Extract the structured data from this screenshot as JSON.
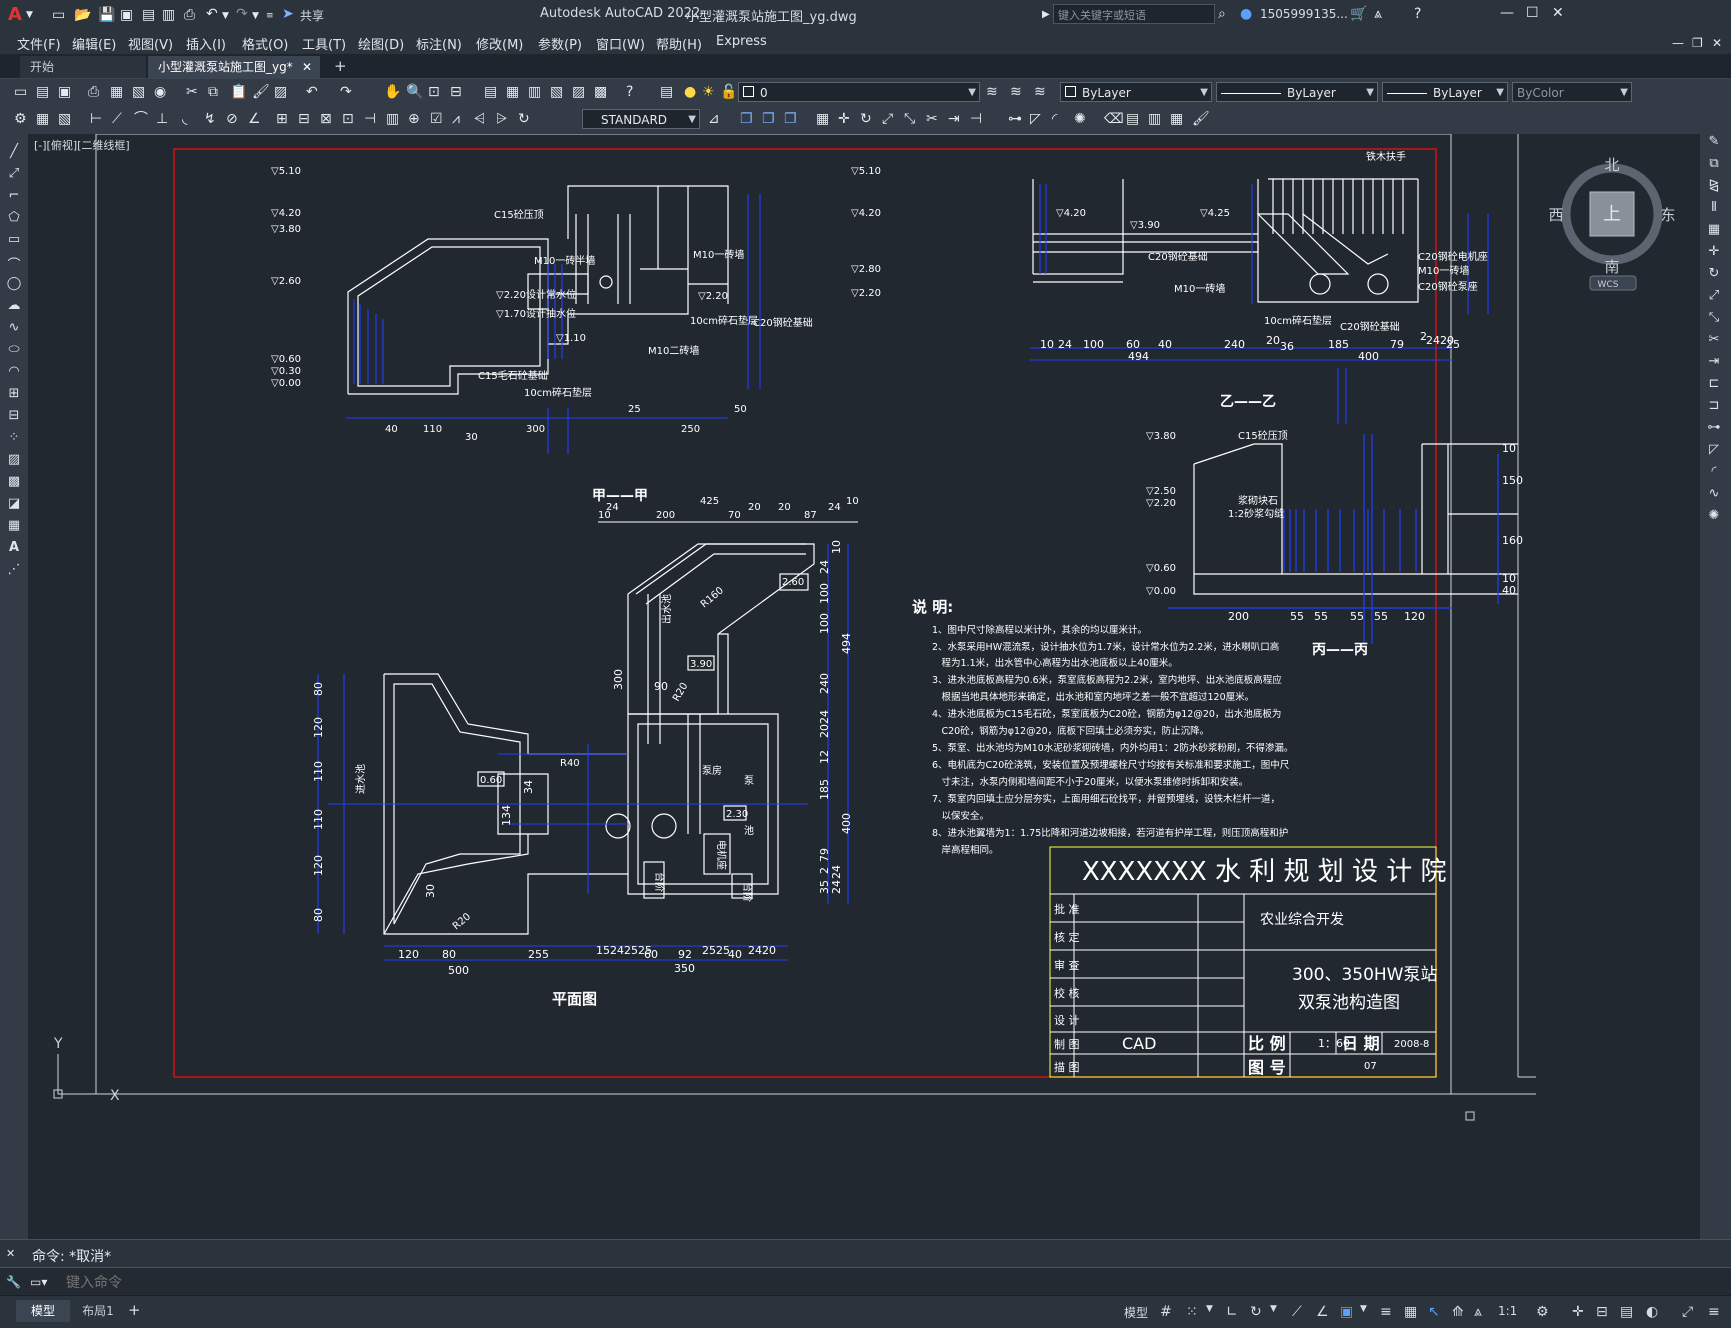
{
  "app": {
    "title": "Autodesk AutoCAD 2022",
    "filename": "小型灌溉泵站施工图_yg.dwg",
    "logo": "A",
    "share_label": "共享",
    "search_placeholder": "键入关键字或短语",
    "user": "1505999135..."
  },
  "menu": [
    "文件(F)",
    "编辑(E)",
    "视图(V)",
    "插入(I)",
    "格式(O)",
    "工具(T)",
    "绘图(D)",
    "标注(N)",
    "修改(M)",
    "参数(P)",
    "窗口(W)",
    "帮助(H)",
    "Express"
  ],
  "tabs": {
    "start": "开始",
    "active": "小型灌溉泵站施工图_yg*",
    "plus": "+"
  },
  "toolbar": {
    "layer": "0",
    "color": "ByLayer",
    "linetype": "ByLayer",
    "lineweight": "ByLayer",
    "plotstyle": "ByColor",
    "textstyle": "STANDARD"
  },
  "viewport": {
    "label": "[-][俯视][二维线框]",
    "compass": {
      "north": "北",
      "south": "南",
      "east": "东",
      "west": "西",
      "top": "上",
      "wcs": "WCS"
    },
    "ucs_x": "X",
    "ucs_y": "Y"
  },
  "drawing": {
    "sections": {
      "a": "甲——甲",
      "b": "乙——乙",
      "c": "丙——丙",
      "plan": "平面图"
    },
    "notes_title": "说 明:",
    "notes": [
      "1、图中尺寸除高程以米计外，其余的均以厘米计。",
      "2、水泵采用HW混流泵，设计抽水位为1.7米，设计常水位为2.2米，进水喇叭口高",
      "　程为1.1米，出水管中心高程为出水池底板以上40厘米。",
      "3、进水池底板高程为0.6米，泵室底板高程为2.2米，室内地坪、出水池底板高程应",
      "　根据当地具体地形来确定，出水池和室内地坪之差一般不宜超过120厘米。",
      "4、进水池底板为C15毛石砼，泵室底板为C20砼，钢筋为φ12@20，出水池底板为",
      "　C20砼，钢筋为φ12@20，底板下回填土必须夯实，防止沉降。",
      "5、泵室、出水池均为M10水泥砂浆砌砖墙，内外均用1：2防水砂浆粉刷，不得渗漏。",
      "6、电机底为C20砼浇筑，安装位置及预埋螺栓尺寸均按有关标准和要求施工，图中尺",
      "　寸未注，水泵内侧和墙间距不小于20厘米，以便水泵维修时拆卸和安装。",
      "7、泵室内回填土应分层夯实，上面用细石砼找平，并留预埋线，设铁木栏杆一道，",
      "　以保安全。",
      "8、进水池翼墙为1：1.75比降和河道边坡相接，若河道有护岸工程，则压顶高程和护",
      "　岸高程相同。"
    ],
    "labels_a": [
      "▽5.10",
      "▽4.20",
      "▽3.80",
      "▽2.60",
      "▽0.60",
      "▽0.30",
      "▽0.00",
      "C15砼压顶",
      "M10一砖半墙",
      "M10一砖墙",
      "▽2.20设计常水位",
      "▽1.70设计抽水位",
      "▽1.10",
      "▽2.20",
      "10cm碎石垫层",
      "C20钢砼基础",
      "M10二砖墙",
      "C15毛石砼基础",
      "10cm碎石垫层"
    ],
    "labels_b": [
      "▽5.10",
      "▽4.20",
      "▽2.80",
      "▽2.20",
      "▽4.20",
      "▽3.90",
      "▽4.25",
      "铁木扶手",
      "C20钢砼基础",
      "M10一砖墙",
      "C20钢砼电机座",
      "M10一砖墙",
      "C20钢砼泵座",
      "10cm碎石垫层",
      "C20钢砼基础"
    ],
    "labels_c": [
      "▽3.80",
      "▽2.50",
      "▽2.20",
      "▽0.60",
      "▽0.00",
      "C15砼压顶",
      "浆砌块石",
      "1:2砂浆勾缝"
    ],
    "labels_plan": [
      "进水池",
      "出水池",
      "泵房",
      "泵",
      "池",
      "R160",
      "R40",
      "R20",
      "R20",
      "0.60",
      "2.30",
      "2.60",
      "3.90",
      "电机座",
      "台阶",
      "台阶"
    ],
    "dims_a": [
      "40",
      "110",
      "30",
      "300",
      "25",
      "50",
      "250",
      "24",
      "200",
      "425",
      "20",
      "70",
      "20",
      "87",
      "24",
      "10",
      "10"
    ],
    "dims_b": [
      "10",
      "24",
      "100",
      "60",
      "40",
      "494",
      "240",
      "20",
      "36",
      "185",
      "400",
      "79",
      "2",
      "2420",
      "25"
    ],
    "dims_c": [
      "200",
      "55",
      "55",
      "55",
      "55",
      "120",
      "10",
      "150",
      "160",
      "10",
      "40"
    ],
    "dims_plan_bottom": [
      "120",
      "80",
      "500",
      "255",
      "15",
      "24",
      "25",
      "25",
      "60",
      "92",
      "25",
      "25",
      "40",
      "2420",
      "350"
    ],
    "dims_plan_left": [
      "80",
      "120",
      "110",
      "110",
      "120",
      "80",
      "30"
    ],
    "dims_plan_right": [
      "10",
      "24",
      "100",
      "100",
      "494",
      "240",
      "24",
      "20",
      "12",
      "185",
      "400",
      "79",
      "2",
      "35",
      "24",
      "24"
    ],
    "dims_plan_inner": [
      "300",
      "90",
      "134",
      "34"
    ]
  },
  "titleblock": {
    "institute": "XXXXXXX 水 利 规 划 设 计 院",
    "project": "农业综合开发",
    "drawing_title_1": "300、350HW泵站",
    "drawing_title_2": "双泵池构造图",
    "rows": [
      "批 准",
      "核 定",
      "审 查",
      "校 核",
      "设 计",
      "制 图",
      "描 图"
    ],
    "drawn_by": "CAD",
    "scale_label": "比 例",
    "scale_value": "1：60",
    "date_label": "日 期",
    "date_value": "2008-8",
    "number_label": "图 号",
    "number_value": "07"
  },
  "command": {
    "history": "命令: *取消*",
    "placeholder": "键入命令"
  },
  "status": {
    "model_tab": "模型",
    "layout_tab": "布局1",
    "add": "+",
    "model_btn": "模型",
    "scale": "1:1"
  },
  "colors": {
    "bg": "#212830",
    "border_red": "#e01010",
    "dim_blue": "#2040ff",
    "line_white": "#ffffff"
  }
}
